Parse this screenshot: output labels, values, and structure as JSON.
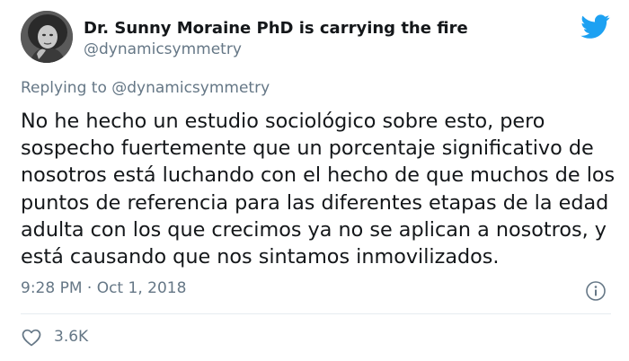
{
  "author": {
    "display_name": "Dr. Sunny Moraine PhD is carrying the fire",
    "handle": "@dynamicsymmetry"
  },
  "reply_context": {
    "prefix": "Replying to",
    "mention": "@dynamicsymmetry"
  },
  "tweet": {
    "text": "No he hecho un estudio sociológico sobre esto, pero\nsospecho fuertemente que un porcentaje significativo de\nnosotros está luchando con el hecho de que muchos de los\npuntos de referencia para las diferentes etapas de la edad\nadulta con los que crecimos ya no se aplican a nosotros, y\nestá causando que nos sintamos inmovilizados.",
    "timestamp": "9:28 PM · Oct 1, 2018"
  },
  "engagement": {
    "likes": "3.6K"
  },
  "icons": {
    "brand": "twitter-bird-icon",
    "info": "info-icon",
    "like": "heart-icon"
  },
  "colors": {
    "brand_blue": "#1da1f2",
    "text_primary": "#14171a",
    "text_secondary": "#657786",
    "divider": "#e6ecf0"
  }
}
